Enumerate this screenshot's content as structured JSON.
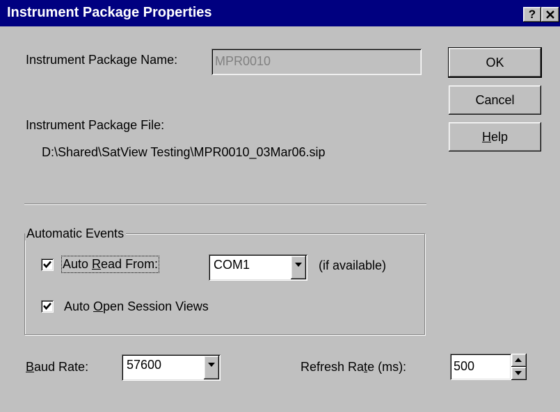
{
  "window": {
    "title": "Instrument Package Properties",
    "help_caption": "?",
    "close_caption": "✕"
  },
  "name_field": {
    "label": "Instrument Package Name:",
    "value": "MPR0010"
  },
  "file": {
    "label": "Instrument Package File:",
    "path": "D:\\Shared\\SatView Testing\\MPR0010_03Mar06.sip"
  },
  "buttons": {
    "ok": "OK",
    "cancel": "Cancel",
    "help_pre": "",
    "help_mnemonic": "H",
    "help_post": "elp"
  },
  "automatic_events": {
    "legend": "Automatic Events",
    "auto_read": {
      "checked": true,
      "label_pre": "Auto ",
      "label_mnemonic": "R",
      "label_post": "ead From:",
      "port": "COM1",
      "note": "(if available)"
    },
    "auto_open": {
      "checked": true,
      "label_pre": "Auto ",
      "label_mnemonic": "O",
      "label_post": "pen Session Views"
    }
  },
  "baud": {
    "label_pre": "",
    "label_mnemonic": "B",
    "label_post": "aud Rate:",
    "value": "57600"
  },
  "refresh": {
    "label_pre": "Refresh Ra",
    "label_mnemonic": "t",
    "label_post": "e (ms):",
    "value": "500"
  },
  "colors": {
    "title_bar": "#000080",
    "face": "#c0c0c0",
    "disabled_text": "#808080"
  }
}
